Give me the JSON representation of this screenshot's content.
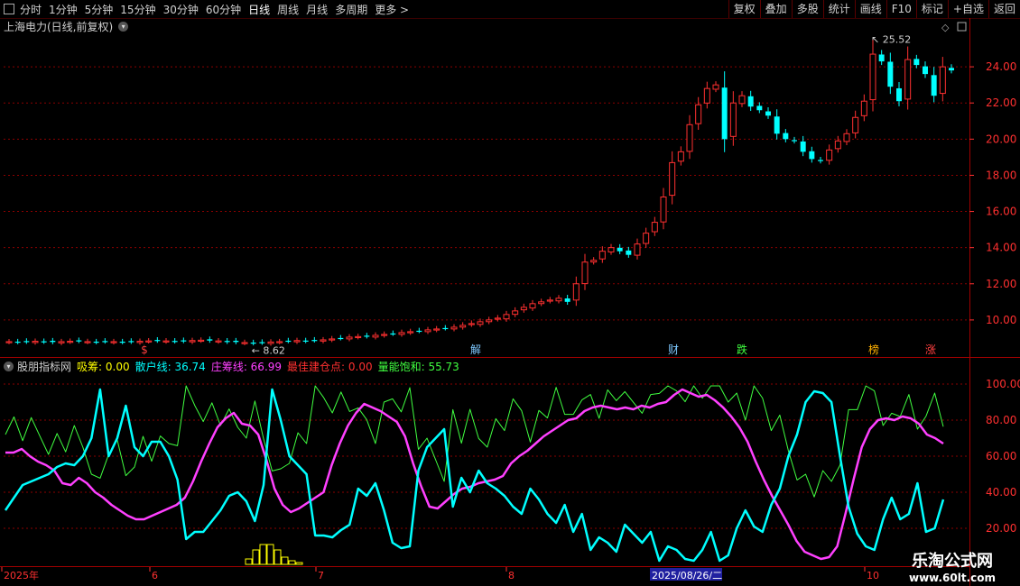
{
  "toolbar": {
    "periods": [
      "分时",
      "1分钟",
      "5分钟",
      "15分钟",
      "30分钟",
      "60分钟",
      "日线",
      "周线",
      "月线",
      "多周期",
      "更多 >"
    ],
    "buttons": [
      "复权",
      "叠加",
      "多股",
      "统计",
      "画线",
      "F10",
      "标记",
      "+自选",
      "返回"
    ]
  },
  "main_title": "上海电力(日线,前复权)",
  "main_axis": [
    24.0,
    22.0,
    20.0,
    18.0,
    16.0,
    14.0,
    12.0,
    10.0
  ],
  "annotations": {
    "high": "25.52",
    "low": "8.62"
  },
  "events": [
    {
      "label": "$",
      "color": "#ff4040"
    },
    {
      "label": "解",
      "color": "#7ec8ff"
    },
    {
      "label": "财",
      "color": "#7ec8ff"
    },
    {
      "label": "跌",
      "color": "#40ff40"
    },
    {
      "label": "榜",
      "color": "#ffb000"
    },
    {
      "label": "涨",
      "color": "#ff4040"
    }
  ],
  "indicator": {
    "name": "股朋指标网",
    "fields": [
      {
        "label": "吸筹: 0.00",
        "color": "#ffff00"
      },
      {
        "label": "散户线: 36.74",
        "color": "#00ffff"
      },
      {
        "label": "庄筹线: 66.99",
        "color": "#ff40ff"
      },
      {
        "label": "最佳建仓点: 0.00",
        "color": "#ff3030"
      },
      {
        "label": "量能饱和: 55.73",
        "color": "#40ff40"
      }
    ],
    "axis": [
      100.0,
      80.0,
      60.0,
      40.0,
      20.0
    ]
  },
  "xaxis": [
    {
      "label": "2025年",
      "highlight": false
    },
    {
      "label": "6",
      "highlight": false
    },
    {
      "label": "7",
      "highlight": false
    },
    {
      "label": "8",
      "highlight": false
    },
    {
      "label": "2025/08/26/二",
      "highlight": true
    },
    {
      "label": "10",
      "highlight": false
    }
  ],
  "watermark": {
    "line1": "乐淘公式网",
    "line2": "www.60lt.com"
  },
  "colors": {
    "up": "#ff3030",
    "down": "#00ffff",
    "grid": "#8b0000",
    "axis": "#ff3030"
  },
  "chart_data": {
    "type": "candlestick",
    "close_approx": [
      8.8,
      8.78,
      8.8,
      8.82,
      8.8,
      8.78,
      8.8,
      8.82,
      8.84,
      8.8,
      8.78,
      8.82,
      8.8,
      8.78,
      8.8,
      8.82,
      8.84,
      8.86,
      8.84,
      8.82,
      8.84,
      8.86,
      8.88,
      8.86,
      8.84,
      8.8,
      8.78,
      8.75,
      8.72,
      8.75,
      8.78,
      8.8,
      8.84,
      8.86,
      8.84,
      8.88,
      8.9,
      8.95,
      9.0,
      9.05,
      9.08,
      9.1,
      9.15,
      9.2,
      9.25,
      9.3,
      9.35,
      9.4,
      9.45,
      9.5,
      9.55,
      9.6,
      9.7,
      9.8,
      9.9,
      10.0,
      10.1,
      10.3,
      10.5,
      10.7,
      10.9,
      11.0,
      11.1,
      11.2,
      11.0,
      12.0,
      13.2,
      13.3,
      13.8,
      14.0,
      13.8,
      13.6,
      14.2,
      14.8,
      15.4,
      16.8,
      18.7,
      19.3,
      20.8,
      21.9,
      22.8,
      23.0,
      20.0,
      22.0,
      22.4,
      21.8,
      21.6,
      21.3,
      20.3,
      20.0,
      19.9,
      19.3,
      18.9,
      18.8,
      19.4,
      19.9,
      20.3,
      21.2,
      22.1,
      24.7,
      24.3,
      22.9,
      22.1,
      24.4,
      24.1,
      23.6,
      22.4,
      24.0,
      23.8
    ],
    "indicator_series": {
      "庄筹线": [
        62,
        62,
        64,
        60,
        57,
        55,
        52,
        45,
        44,
        48,
        45,
        40,
        37,
        33,
        30,
        27,
        25,
        25,
        27,
        29,
        31,
        33,
        37,
        46,
        57,
        67,
        76,
        81,
        84,
        78,
        77,
        72,
        58,
        42,
        33,
        29,
        31,
        34,
        37,
        40,
        55,
        67,
        77,
        84,
        89,
        87,
        85,
        82,
        79,
        71,
        56,
        43,
        32,
        31,
        35,
        39,
        42,
        43,
        45,
        46,
        47,
        49,
        56,
        60,
        63,
        67,
        71,
        74,
        77,
        80,
        81,
        85,
        87,
        88,
        87,
        86,
        87,
        86,
        88,
        87,
        89,
        90,
        94,
        97,
        95,
        93,
        94,
        91,
        87,
        82,
        76,
        68,
        57,
        47,
        38,
        30,
        22,
        13,
        7,
        5,
        3,
        4,
        10,
        28,
        47,
        65,
        75,
        80,
        81,
        80,
        82,
        81,
        78,
        72,
        70,
        67
      ],
      "散户线": [
        30,
        37,
        44,
        46,
        48,
        50,
        54,
        56,
        55,
        60,
        70,
        97,
        60,
        70,
        88,
        65,
        60,
        68,
        68,
        60,
        47,
        14,
        18,
        18,
        24,
        30,
        38,
        40,
        35,
        24,
        44,
        97,
        80,
        60,
        55,
        50,
        16,
        16,
        15,
        19,
        22,
        42,
        38,
        45,
        30,
        12,
        9,
        10,
        52,
        65,
        70,
        75,
        32,
        48,
        40,
        52,
        45,
        42,
        38,
        32,
        28,
        42,
        36,
        28,
        23,
        33,
        18,
        28,
        8,
        15,
        12,
        7,
        22,
        17,
        12,
        18,
        2,
        10,
        8,
        3,
        2,
        8,
        18,
        2,
        5,
        20,
        30,
        21,
        18,
        33,
        42,
        60,
        72,
        90,
        96,
        95,
        90,
        60,
        32,
        17,
        10,
        8,
        25,
        37,
        25,
        28,
        45,
        18,
        20,
        36
      ]
    }
  }
}
